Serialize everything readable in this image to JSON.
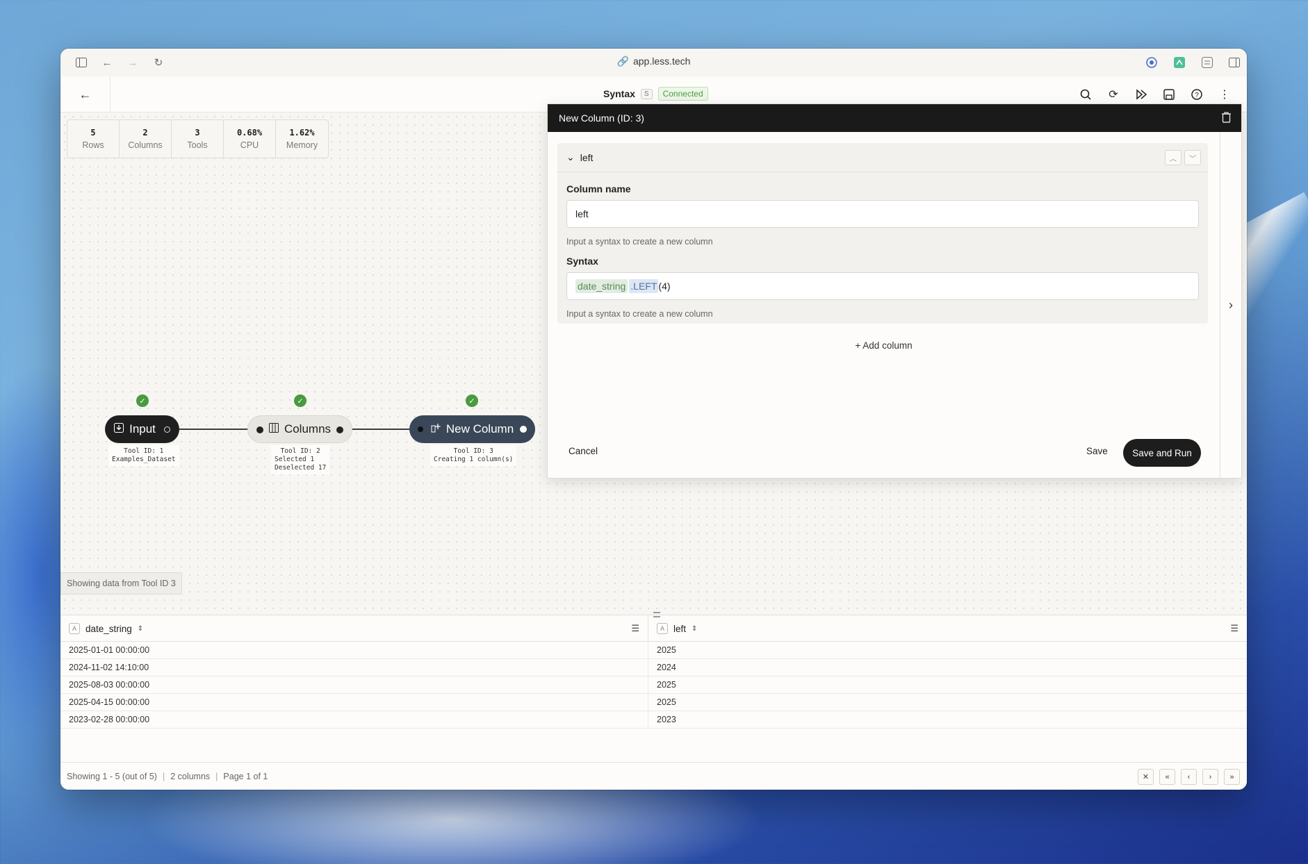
{
  "browser": {
    "url": "app.less.tech",
    "nav_icons": [
      "sidebar-toggle-icon",
      "back-arrow-icon",
      "forward-arrow-icon",
      "reload-icon"
    ],
    "ext_icons": [
      "password-manager-icon",
      "extension-icon",
      "reader-icon",
      "split-view-icon"
    ]
  },
  "header": {
    "title": "Syntax",
    "shortcut": "S",
    "status": "Connected"
  },
  "stats": [
    {
      "value": "5",
      "label": "Rows"
    },
    {
      "value": "2",
      "label": "Columns"
    },
    {
      "value": "3",
      "label": "Tools"
    },
    {
      "value": "0.68%",
      "label": "CPU"
    },
    {
      "value": "1.62%",
      "label": "Memory"
    }
  ],
  "nodes": {
    "input": {
      "label": "Input",
      "info1": "Tool ID: 1",
      "info2": "Examples_Dataset"
    },
    "columns": {
      "label": "Columns",
      "info1": "Tool ID: 2",
      "info2": "Selected 1",
      "info3": "Deselected 17"
    },
    "newcol": {
      "label": "New Column",
      "info1": "Tool ID: 3",
      "info2": "Creating 1 column(s)"
    }
  },
  "showing_tool": "Showing data from Tool ID 3",
  "panel": {
    "title": "New Column (ID: 3)",
    "section_label": "left",
    "column_name_label": "Column name",
    "column_name_value": "left",
    "column_name_help": "Input a syntax to create a new column",
    "syntax_label": "Syntax",
    "syntax_token_col": "date_string",
    "syntax_token_fn": ".LEFT",
    "syntax_token_arg": "(4)",
    "syntax_help": "Input a syntax to create a new column",
    "add_column": "Add column",
    "cancel": "Cancel",
    "save": "Save",
    "save_run": "Save and Run"
  },
  "grid": {
    "columns": [
      "date_string",
      "left"
    ],
    "rows": [
      [
        "2025-01-01 00:00:00",
        "2025"
      ],
      [
        "2024-11-02 14:10:00",
        "2024"
      ],
      [
        "2025-08-03 00:00:00",
        "2025"
      ],
      [
        "2025-04-15 00:00:00",
        "2025"
      ],
      [
        "2023-02-28 00:00:00",
        "2023"
      ]
    ],
    "footer": {
      "showing": "Showing 1 - 5 (out of 5)",
      "columns": "2 columns",
      "page": "Page 1 of 1"
    }
  }
}
